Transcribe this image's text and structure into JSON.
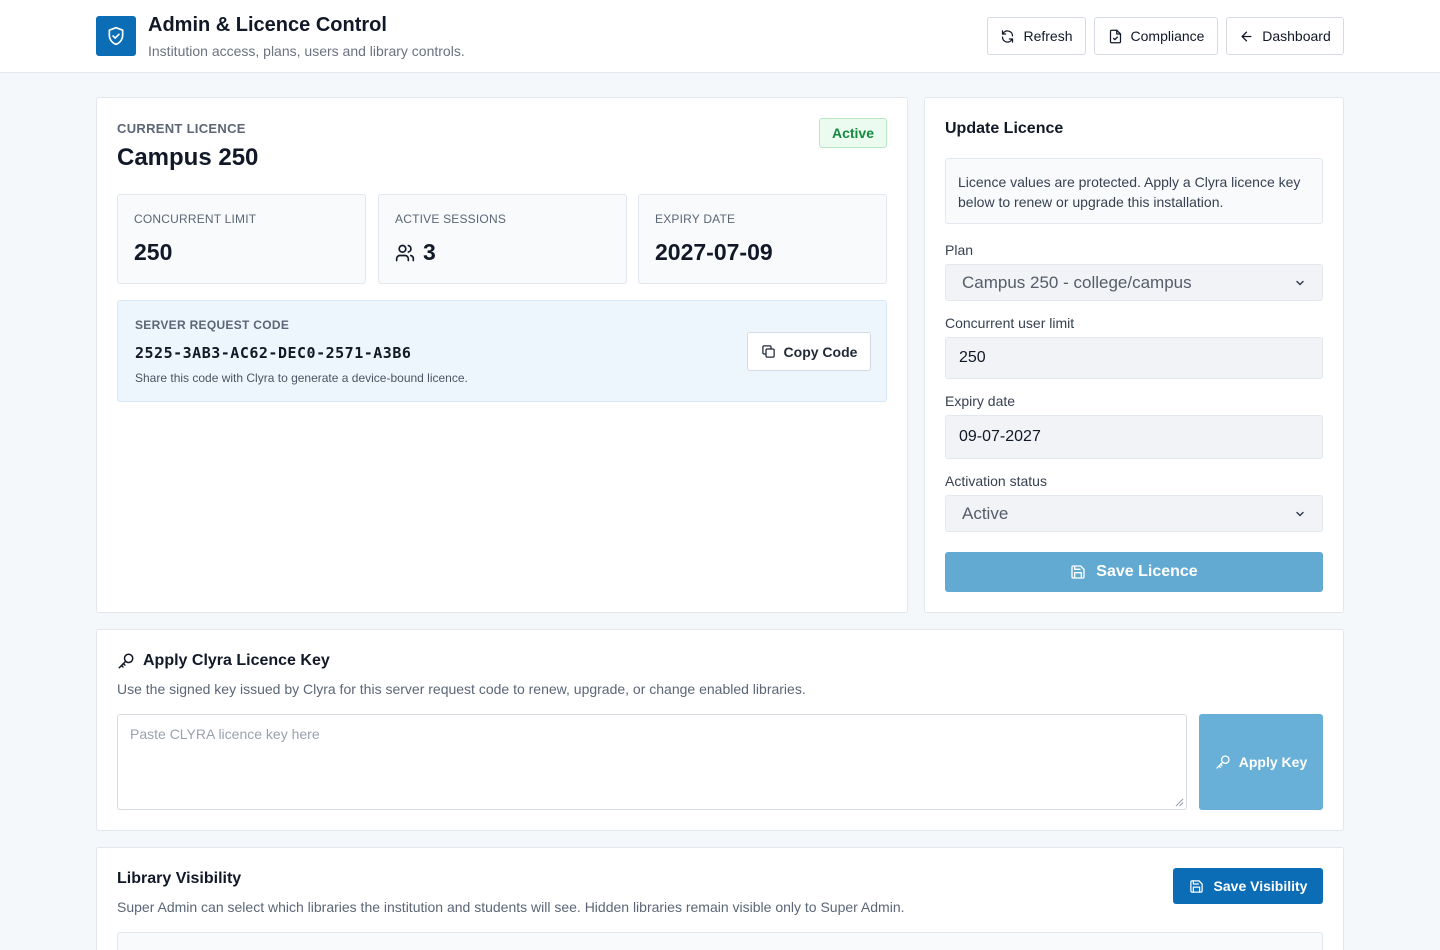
{
  "header": {
    "title": "Admin & Licence Control",
    "subtitle": "Institution access, plans, users and library controls.",
    "buttons": {
      "refresh": "Refresh",
      "compliance": "Compliance",
      "dashboard": "Dashboard"
    }
  },
  "current": {
    "eyebrow": "CURRENT LICENCE",
    "plan": "Campus 250",
    "status": "Active",
    "stats": {
      "concurrent": {
        "label": "CONCURRENT LIMIT",
        "value": "250"
      },
      "sessions": {
        "label": "ACTIVE SESSIONS",
        "value": "3",
        "icon": "users-icon"
      },
      "expiry": {
        "label": "EXPIRY DATE",
        "value": "2027-07-09"
      }
    },
    "request": {
      "label": "SERVER REQUEST CODE",
      "code": "2525-3AB3-AC62-DEC0-2571-A3B6",
      "note": "Share this code with Clyra to generate a device-bound licence.",
      "copy_label": "Copy Code"
    }
  },
  "update": {
    "title": "Update Licence",
    "info": "Licence values are protected. Apply a Clyra licence key below to renew or upgrade this installation.",
    "plan_label": "Plan",
    "plan_value": "Campus 250 - college/campus",
    "limit_label": "Concurrent user limit",
    "limit_value": "250",
    "expiry_label": "Expiry date",
    "expiry_value": "09-07-2027",
    "status_label": "Activation status",
    "status_value": "Active",
    "save_label": "Save Licence"
  },
  "key": {
    "title": "Apply Clyra Licence Key",
    "desc": "Use the signed key issued by Clyra for this server request code to renew, upgrade, or change enabled libraries.",
    "placeholder": "Paste CLYRA licence key here",
    "apply_label": "Apply Key"
  },
  "visibility": {
    "title": "Library Visibility",
    "desc": "Super Admin can select which libraries the institution and students will see. Hidden libraries remain visible only to Super Admin.",
    "save_label": "Save Visibility"
  },
  "colors": {
    "brand": "#0a6db5",
    "save_disabled": "#63aad3",
    "active_badge": "#138a3f"
  }
}
